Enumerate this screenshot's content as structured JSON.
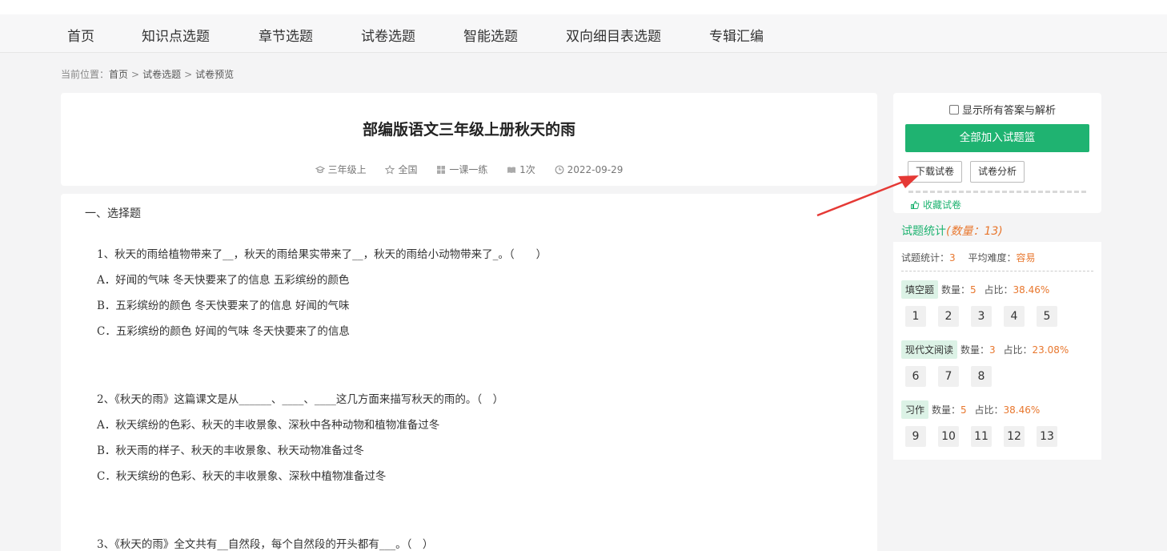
{
  "nav": {
    "items": [
      "首页",
      "知识点选题",
      "章节选题",
      "试卷选题",
      "智能选题",
      "双向细目表选题",
      "专辑汇编"
    ]
  },
  "breadcrumb": {
    "prefix": "当前位置：",
    "items": [
      "首页",
      "试卷选题",
      "试卷预览"
    ],
    "separator": ">"
  },
  "paper": {
    "title": "部编版语文三年级上册秋天的雨",
    "meta": {
      "grade": "三年级上",
      "region": "全国",
      "type": "一课一练",
      "views": "1次",
      "date": "2022-09-29"
    }
  },
  "content": {
    "section_title": "一、选择题",
    "questions": [
      {
        "stem": "1、秋天的雨给植物带来了__，秋天的雨给果实带来了__，秋天的雨给小动物带来了_。（　　）",
        "options": [
          "A．好闻的气味 冬天快要来了的信息 五彩缤纷的颜色",
          "B．五彩缤纷的颜色 冬天快要来了的信息 好闻的气味",
          "C．五彩缤纷的颜色 好闻的气味 冬天快要来了的信息"
        ]
      },
      {
        "stem": "2、《秋天的雨》这篇课文是从______、____、____这几方面来描写秋天的雨的。（　）",
        "options": [
          "A．秋天缤纷的色彩、秋天的丰收景象、深秋中各种动物和植物准备过冬",
          "B．秋天雨的样子、秋天的丰收景象、秋天动物准备过冬",
          "C．秋天缤纷的色彩、秋天的丰收景象、深秋中植物准备过冬"
        ]
      },
      {
        "stem": "3、《秋天的雨》全文共有__自然段，每个自然段的开头都有___。（　）",
        "options": []
      }
    ]
  },
  "sidebar": {
    "show_answers_label": "显示所有答案与解析",
    "add_all_label": "全部加入试题篮",
    "download_label": "下载试卷",
    "analysis_label": "试卷分析",
    "favorite_label": "收藏试卷"
  },
  "stats": {
    "heading": "试题统计",
    "heading_count": "(数量：13)",
    "summary_label": "试题统计：",
    "summary_value": "3",
    "difficulty_label": "平均难度：",
    "difficulty_value": "容易",
    "count_label": "数量：",
    "ratio_label": "占比：",
    "groups": [
      {
        "name": "填空题",
        "count": "5",
        "ratio": "38.46%",
        "numbers": [
          "1",
          "2",
          "3",
          "4",
          "5"
        ]
      },
      {
        "name": "现代文阅读",
        "count": "3",
        "ratio": "23.08%",
        "numbers": [
          "6",
          "7",
          "8"
        ]
      },
      {
        "name": "习作",
        "count": "5",
        "ratio": "38.46%",
        "numbers": [
          "9",
          "10",
          "11",
          "12",
          "13"
        ]
      }
    ]
  },
  "colors": {
    "accent_green": "#1fb371",
    "accent_orange": "#e8772e",
    "arrow_red": "#e53935"
  }
}
